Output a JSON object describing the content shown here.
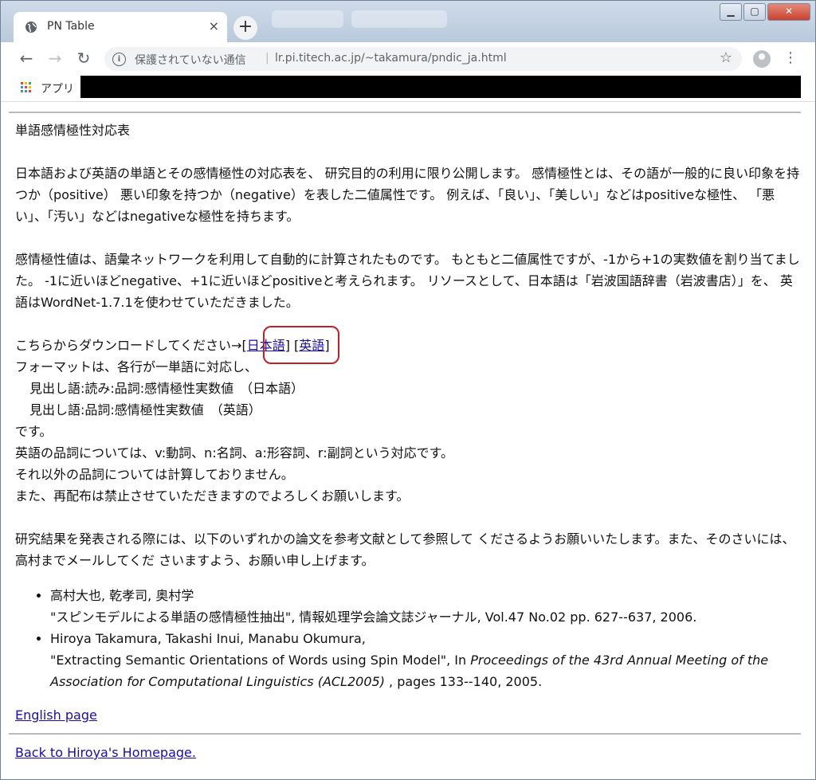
{
  "browser": {
    "tab_title": "PN Table",
    "tab_close": "×",
    "new_tab": "+",
    "security_label": "保護されていない通信",
    "separator": "|",
    "url": "lr.pi.titech.ac.jp/~takamura/pndic_ja.html",
    "apps_label": "アプリ"
  },
  "content": {
    "heading": "単語感情極性対応表",
    "para1": "日本語および英語の単語とその感情極性の対応表を、 研究目的の利用に限り公開します。 感情極性とは、その語が一般的に良い印象を持つか（positive） 悪い印象を持つか（negative）を表した二値属性です。 例えば、「良い」、「美しい」などはpositiveな極性、 「悪い」、「汚い」などはnegativeな極性を持ちます。",
    "para2": "感情極性値は、語彙ネットワークを利用して自動的に計算されたものです。 もともと二値属性ですが、-1から+1の実数値を割り当てました。 -1に近いほどnegative、+1に近いほどpositiveと考えられます。 リソースとして、日本語は「岩波国語辞書（岩波書店）」を、 英語はWordNet-1.7.1を使わせていただきました。",
    "download_prefix": "こちらからダウンロードしてください→[",
    "link_japanese": "日本語",
    "download_mid": "] [",
    "link_english": "英語",
    "download_suffix": "]",
    "format_line1": "フォーマットは、各行が一単語に対応し、",
    "format_line2": "見出し語:読み:品詞:感情極性実数値　（日本語）",
    "format_line3": "見出し語:品詞:感情極性実数値　（英語）",
    "format_line4": "です。",
    "format_line5": "英語の品詞については、v:動詞、n:名詞、a:形容詞、r:副詞という対応です。",
    "format_line6": "それ以外の品詞については計算しておりません。",
    "format_line7": "また、再配布は禁止させていただきますのでよろしくお願いします。",
    "para3": "研究結果を発表される際には、以下のいずれかの論文を参考文献として参照して くださるようお願いいたします。また、そのさいには、高村までメールしてくだ さいますよう、お願い申し上げます。",
    "ref1_authors": "高村大也, 乾孝司, 奥村学",
    "ref1_title": "\"スピンモデルによる単語の感情極性抽出\", 情報処理学会論文誌ジャーナル, Vol.47 No.02 pp. 627--637, 2006.",
    "ref2_authors": "Hiroya Takamura, Takashi Inui, Manabu Okumura,",
    "ref2_title_prefix": "\"Extracting Semantic Orientations of Words using Spin Model\", In ",
    "ref2_venue": "Proceedings of the 43rd Annual Meeting of the Association for Computational Linguistics (ACL2005)",
    "ref2_suffix": " , pages 133--140, 2005.",
    "english_page_link": "English page",
    "back_link": "Back to Hiroya's Homepage."
  },
  "colors": {
    "link": "#1a0dab",
    "annotation_circle": "#c0202a"
  }
}
